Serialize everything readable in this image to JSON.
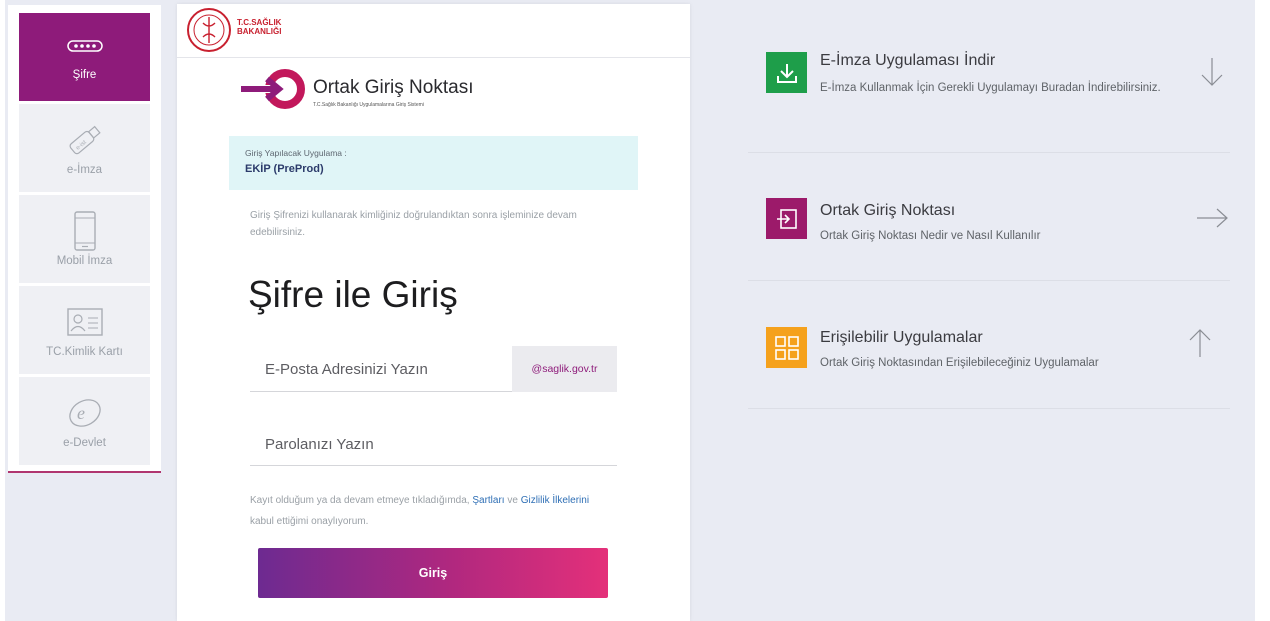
{
  "sidebar": {
    "items": [
      {
        "label": "Şifre",
        "icon": "password-dots-icon"
      },
      {
        "label": "e-İmza",
        "icon": "usb-token-icon"
      },
      {
        "label": "Mobil İmza",
        "icon": "mobile-phone-icon"
      },
      {
        "label": "TC.Kimlik Kartı",
        "icon": "id-card-icon"
      },
      {
        "label": "e-Devlet",
        "icon": "e-devlet-icon"
      }
    ]
  },
  "header": {
    "ministry_line1": "T.C.SAĞLIK",
    "ministry_line2": "BAKANLIĞI"
  },
  "ogn": {
    "title": "Ortak Giriş Noktası",
    "subtitle": "T.C.Sağlık Bakanlığı Uygulamalarına Giriş Sistemi"
  },
  "app": {
    "label": "Giriş Yapılacak Uygulama :",
    "name": "EKİP (PreProd)"
  },
  "info_text": "Giriş Şifrenizi kullanarak kimliğiniz doğrulandıktan sonra işleminize devam edebilirsiniz.",
  "heading": "Şifre ile Giriş",
  "email": {
    "placeholder": "E-Posta Adresinizi Yazın",
    "domain": "@saglik.gov.tr"
  },
  "password": {
    "placeholder": "Parolanızı Yazın"
  },
  "terms": {
    "before": "Kayıt olduğum ya da devam etmeye tıkladığımda, ",
    "link1": "Şartları",
    "middle": " ve ",
    "link2": "Gizlilik İlkelerini",
    "after": " kabul ettiğimi onaylıyorum."
  },
  "login_button": "Giriş",
  "links": [
    {
      "title": "E-İmza Uygulaması İndir",
      "desc": "E-İmza Kullanmak İçin Gerekli Uygulamayı Buradan İndirebilirsiniz.",
      "color": "#1e9e4a",
      "icon": "download-icon",
      "arrow": "arrow-down-icon"
    },
    {
      "title": "Ortak Giriş Noktası",
      "desc": "Ortak Giriş Noktası Nedir ve Nasıl Kullanılır",
      "color": "#9c1a6a",
      "icon": "login-icon",
      "arrow": "arrow-right-icon"
    },
    {
      "title": "Erişilebilir Uygulamalar",
      "desc": "Ortak Giriş Noktasından Erişilebileceğiniz Uygulamalar",
      "color": "#f5a11c",
      "icon": "grid-icon",
      "arrow": "arrow-up-icon"
    }
  ]
}
